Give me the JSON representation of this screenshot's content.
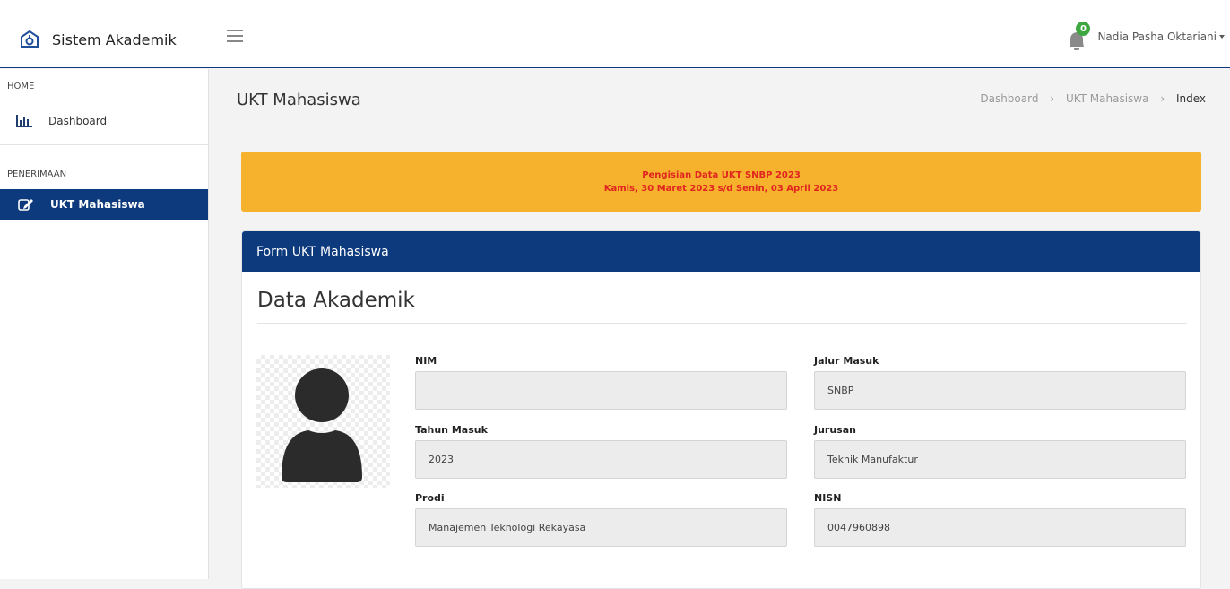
{
  "app": {
    "title": "Sistem Akademik"
  },
  "header": {
    "notification_count": "0",
    "user_name": "Nadia Pasha Oktariani"
  },
  "sidebar": {
    "sections": [
      {
        "label": "HOME",
        "items": [
          {
            "label": "Dashboard",
            "icon": "bar-chart-icon"
          }
        ]
      },
      {
        "label": "PENERIMAAN",
        "items": [
          {
            "label": "UKT Mahasiswa",
            "icon": "edit-icon",
            "active": true
          }
        ]
      }
    ]
  },
  "page": {
    "title": "UKT Mahasiswa",
    "breadcrumb": [
      "Dashboard",
      "UKT Mahasiswa",
      "Index"
    ]
  },
  "alert": {
    "line1": "Pengisian Data UKT SNBP 2023",
    "line2": "Kamis, 30 Maret 2023 s/d Senin, 03 April 2023"
  },
  "form": {
    "header": "Form UKT Mahasiswa",
    "section_title": "Data Akademik",
    "fields": {
      "nim": {
        "label": "NIM",
        "value": ""
      },
      "jalur_masuk": {
        "label": "Jalur Masuk",
        "value": "SNBP"
      },
      "tahun_masuk": {
        "label": "Tahun Masuk",
        "value": "2023"
      },
      "jurusan": {
        "label": "Jurusan",
        "value": "Teknik Manufaktur"
      },
      "prodi": {
        "label": "Prodi",
        "value": "Manajemen Teknologi Rekayasa"
      },
      "nisn": {
        "label": "NISN",
        "value": "0047960898"
      }
    }
  },
  "colors": {
    "primary": "#0c3a7d",
    "alert_bg": "#f6b12d",
    "alert_text": "#e0241f",
    "badge": "#3fa73f"
  }
}
